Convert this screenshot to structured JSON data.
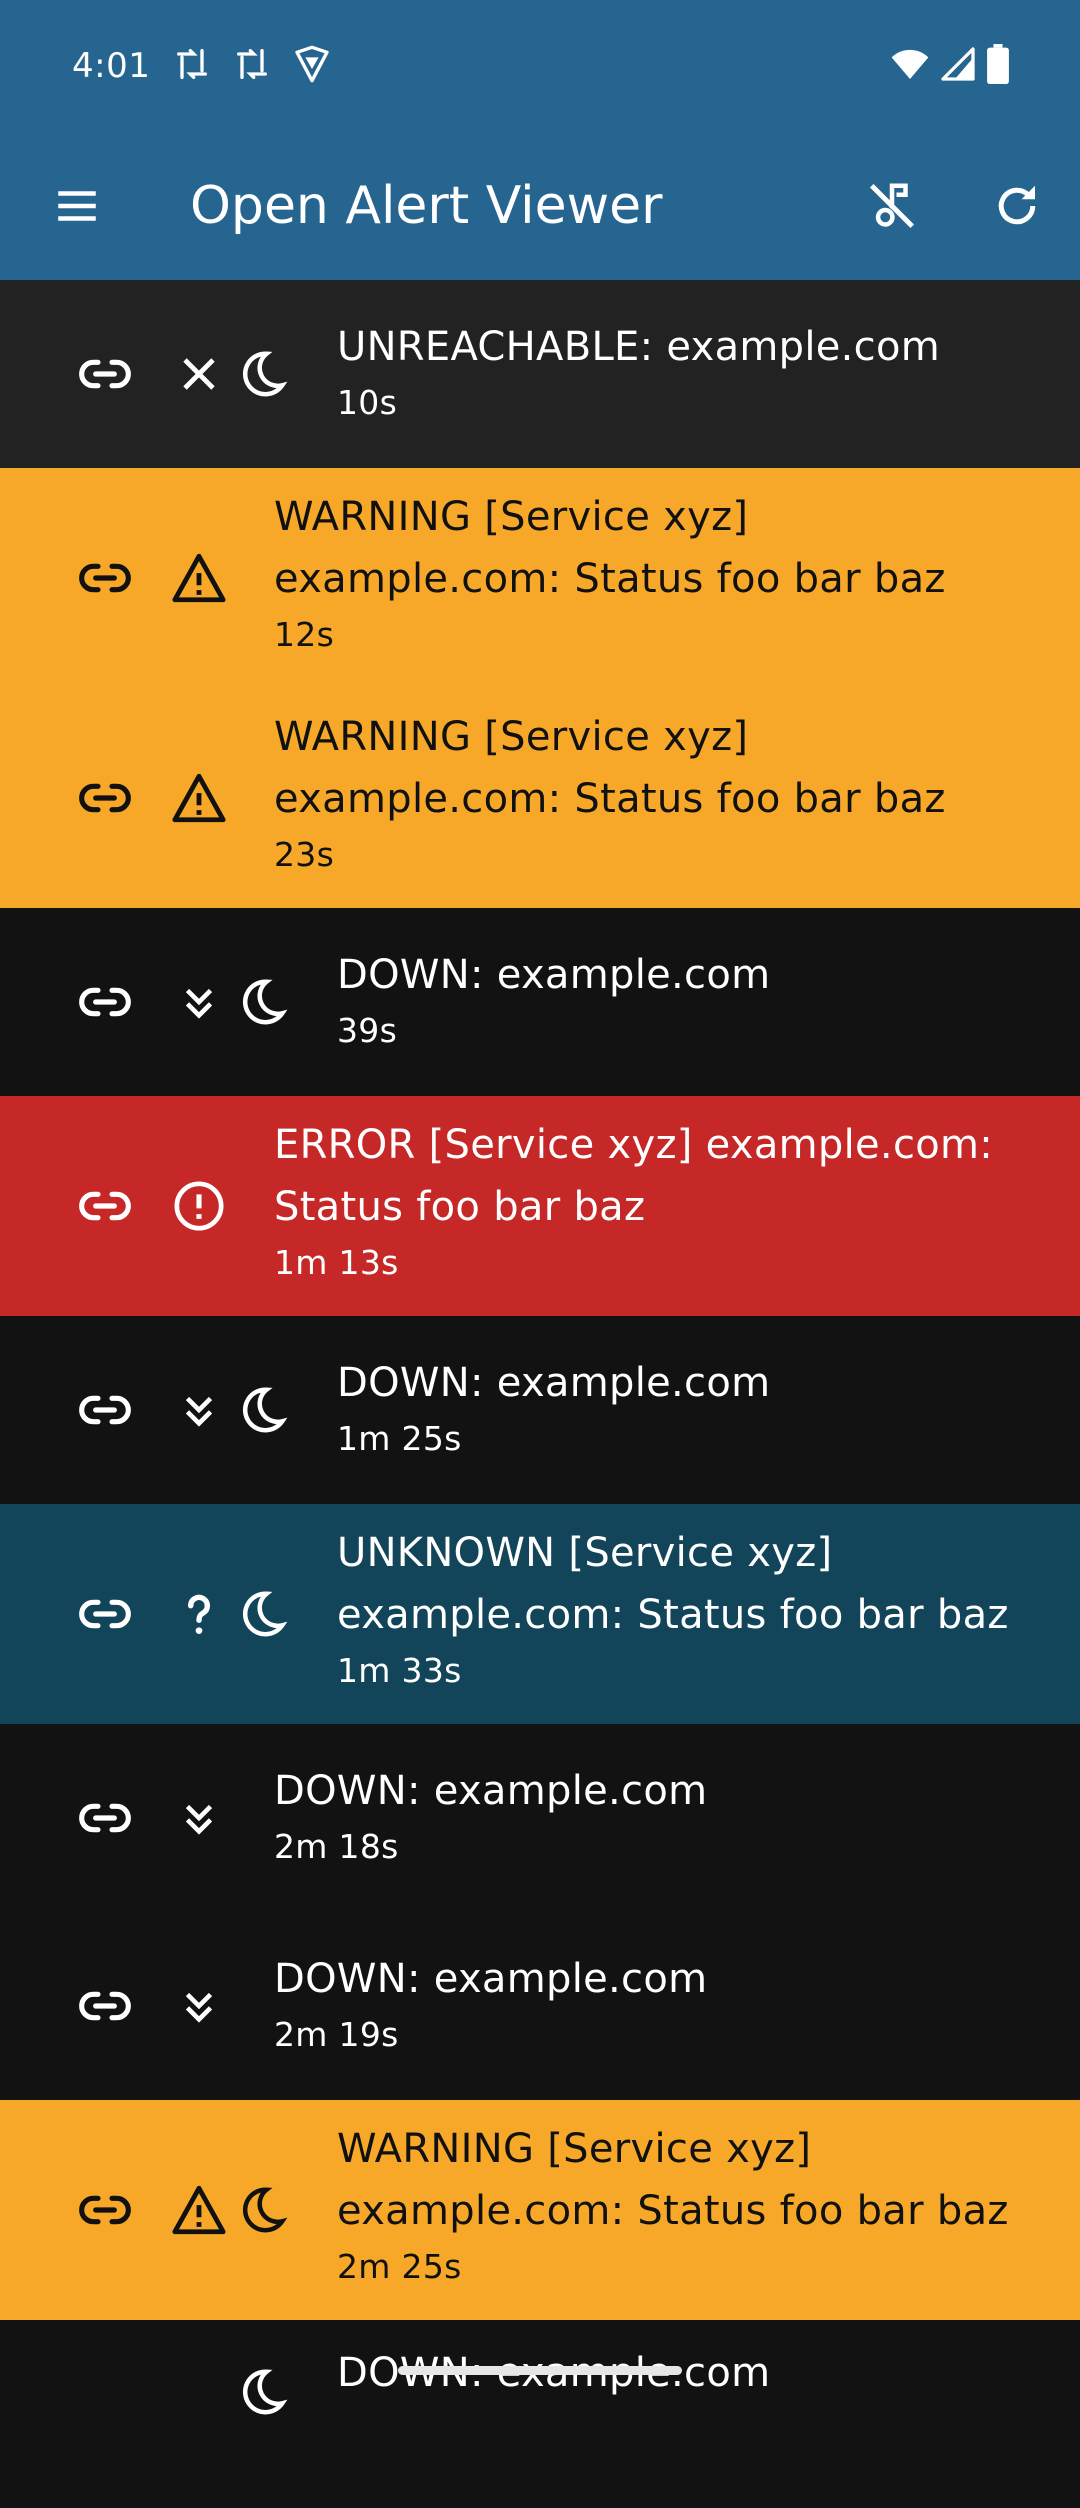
{
  "status_bar": {
    "time": "4:01",
    "left_icons": [
      "sync-icon",
      "sync-icon",
      "vpn-shield-icon"
    ],
    "right_icons": [
      "wifi-icon",
      "signal-icon",
      "battery-icon"
    ]
  },
  "app_bar": {
    "title": "Open Alert Viewer",
    "menu_icon": "menu-icon",
    "mute_icon": "music-off-icon",
    "refresh_icon": "refresh-icon"
  },
  "colors": {
    "app_bar": "#276591",
    "unreachable": "#222222",
    "warning": "#f8a828",
    "down": "#121212",
    "error": "#c62828",
    "unknown": "#12455a"
  },
  "alerts": [
    {
      "kind": "unreachable",
      "status_icon": "close-icon",
      "silenced": true,
      "message_lines": [
        "UNREACHABLE: example.com"
      ],
      "age": "10s"
    },
    {
      "kind": "warning",
      "status_icon": "warning-icon",
      "silenced": false,
      "message_lines": [
        "WARNING [Service xyz]",
        "example.com: Status foo bar baz"
      ],
      "age": "12s"
    },
    {
      "kind": "warning",
      "status_icon": "warning-icon",
      "silenced": false,
      "message_lines": [
        "WARNING [Service xyz]",
        "example.com: Status foo bar baz"
      ],
      "age": "23s"
    },
    {
      "kind": "down",
      "status_icon": "double-chevron-down-icon",
      "silenced": true,
      "message_lines": [
        "DOWN: example.com"
      ],
      "age": "39s"
    },
    {
      "kind": "error",
      "status_icon": "error-circle-icon",
      "silenced": false,
      "message_lines": [
        "ERROR [Service xyz] example.com:",
        "Status foo bar baz"
      ],
      "age": "1m 13s"
    },
    {
      "kind": "down",
      "status_icon": "double-chevron-down-icon",
      "silenced": true,
      "message_lines": [
        "DOWN: example.com"
      ],
      "age": "1m 25s"
    },
    {
      "kind": "unknown",
      "status_icon": "question-icon",
      "silenced": true,
      "message_lines": [
        "UNKNOWN [Service xyz]",
        "example.com: Status foo bar baz"
      ],
      "age": "1m 33s"
    },
    {
      "kind": "down",
      "status_icon": "double-chevron-down-icon",
      "silenced": false,
      "message_lines": [
        "DOWN: example.com"
      ],
      "age": "2m 18s"
    },
    {
      "kind": "down",
      "status_icon": "double-chevron-down-icon",
      "silenced": false,
      "message_lines": [
        "DOWN: example.com"
      ],
      "age": "2m 19s"
    },
    {
      "kind": "warning",
      "status_icon": "warning-icon",
      "silenced": true,
      "message_lines": [
        "WARNING [Service xyz]",
        "example.com: Status foo bar baz"
      ],
      "age": "2m 25s"
    },
    {
      "kind": "down",
      "status_icon": "double-chevron-down-icon",
      "silenced": true,
      "message_lines": [
        "DOWN: example.com"
      ],
      "age": ""
    }
  ]
}
